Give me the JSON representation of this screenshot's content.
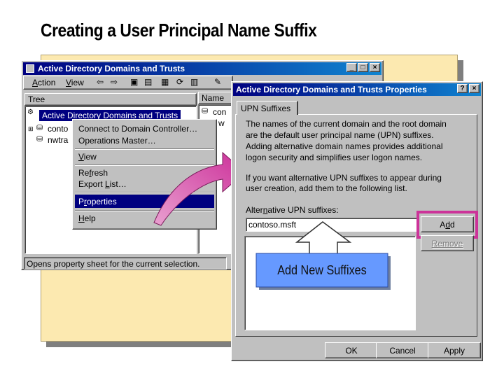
{
  "slide": {
    "title": "Creating a User Principal Name Suffix"
  },
  "mmc": {
    "title": "Active Directory Domains and Trusts",
    "menu": {
      "action": "Action",
      "view": "View"
    },
    "tree_tab": "Tree",
    "name_header": "Name",
    "tree_root": "Active Directory Domains and Trusts",
    "tree_children": [
      "conto",
      "nwtra"
    ],
    "list_items": [
      "con",
      "w"
    ],
    "status": "Opens property sheet for the current selection."
  },
  "context_menu": {
    "connect": "Connect to Domain Controller…",
    "operations": "Operations Master…",
    "view": "View",
    "refresh": "Refresh",
    "export": "Export List…",
    "properties": "Properties",
    "help": "Help"
  },
  "dialog": {
    "title": "Active Directory Domains and Trusts Properties",
    "help_btn": "?",
    "close_btn": "×",
    "tab": "UPN Suffixes",
    "para1": [
      "The names of the current domain and the root domain",
      "are the default user principal name (UPN) suffixes.",
      "Adding alternative domain names provides additional",
      "logon security and simplifies user logon names."
    ],
    "para2": [
      "If you want alternative UPN suffixes to appear during",
      "user creation, add them to the following list."
    ],
    "label": "Alternative UPN suffixes:",
    "input_value": "contoso.msft",
    "add_btn": "Add",
    "remove_btn": "Remove",
    "ok_btn": "OK",
    "cancel_btn": "Cancel",
    "apply_btn": "Apply"
  },
  "callout": {
    "text": "Add New Suffixes"
  },
  "colors": {
    "highlight": "#000080",
    "accent_pink": "#cc3399",
    "callout_fill": "#6699ff",
    "paper": "#fce9b0"
  }
}
